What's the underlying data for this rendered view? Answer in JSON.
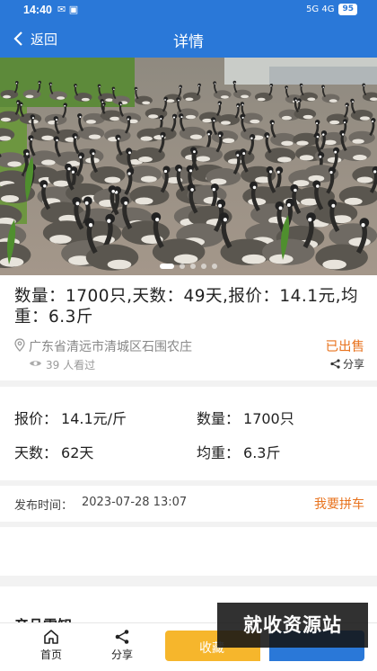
{
  "status_bar": {
    "time": "14:40",
    "left_icons": "✉ ▣",
    "signal_text": "5G  4G",
    "battery": "95"
  },
  "navbar": {
    "back_label": "返回",
    "title": "详情"
  },
  "hero": {
    "image_subject": "geese flock photo",
    "slide_count": 5,
    "active_slide": 0
  },
  "summary": {
    "headline": "数量：1700只,天数：49天,报价：14.1元,均重：6.3斤",
    "location": "广东省清远市清城区石围农庄",
    "status": "已出售",
    "views": "39 人看过",
    "share_label": "分享"
  },
  "details": {
    "price_label": "报价：",
    "price_value": "14.1元/斤",
    "qty_label": "数量：",
    "qty_value": "1700只",
    "days_label": "天数：",
    "days_value": "62天",
    "weight_label": "均重：",
    "weight_value": "6.3斤"
  },
  "publish": {
    "label": "发布时间：",
    "time": "2023-07-28 13:07",
    "action": "我要拼车"
  },
  "section": {
    "title": "产品需知"
  },
  "tabbar": {
    "home_label": "首页",
    "share_label": "分享",
    "favorite_label": "收藏"
  },
  "watermark": "就收资源站",
  "colors": {
    "primary": "#2a78d8",
    "accent": "#e8731e",
    "favorite": "#f6b62c"
  }
}
